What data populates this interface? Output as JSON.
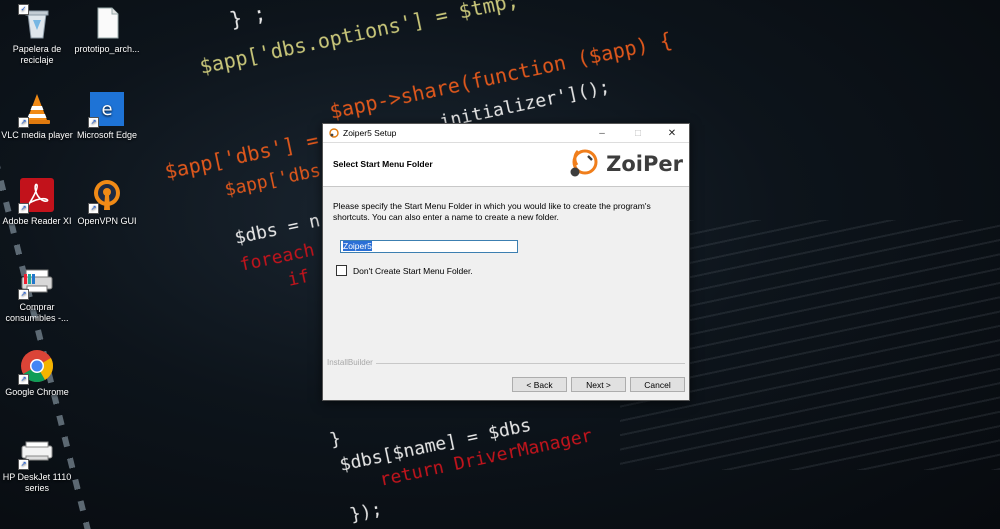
{
  "desktop": {
    "icons": [
      {
        "label": "Papelera de reciclaje",
        "icon": "recycle-bin"
      },
      {
        "label": "prototipo_arch...",
        "icon": "document"
      },
      {
        "label": "VLC media player",
        "icon": "vlc-cone"
      },
      {
        "label": "Microsoft Edge",
        "icon": "edge"
      },
      {
        "label": "Adobe Reader XI",
        "icon": "acrobat"
      },
      {
        "label": "OpenVPN GUI",
        "icon": "openvpn"
      },
      {
        "label": "Comprar consumibles -...",
        "icon": "printer"
      },
      {
        "label": "Google Chrome",
        "icon": "chrome"
      },
      {
        "label": "HP DeskJet 1110 series",
        "icon": "printer"
      }
    ],
    "background_code": [
      "} ;",
      "$app['dbs.options'] = $tmp;",
      "$app->share(function ($app) {",
      "initializer']();",
      "$app['dbs'] = $app",
      "$app['dbs",
      "$dbs = n",
      "foreach",
      "if",
      "}",
      "$dbs[$name] = $dbs",
      "return DriverManager",
      "});"
    ]
  },
  "dialog": {
    "title": "Zoiper5 Setup",
    "header_title": "Select Start Menu Folder",
    "logo_text": "ZoiPer",
    "description": "Please specify the Start Menu Folder in which you would like to create the program's shortcuts. You can also enter a name to create a new folder.",
    "folder_value": "Zoiper5",
    "checkbox_label": "Don't Create Start Menu Folder.",
    "checkbox_checked": false,
    "brand": "InstallBuilder",
    "buttons": {
      "back": "< Back",
      "next": "Next >",
      "cancel": "Cancel"
    },
    "window_controls": {
      "minimize": "–",
      "maximize": "□",
      "close": "✕"
    }
  },
  "colors": {
    "accent": "#2a6fd6",
    "logo_orange": "#f07e1b",
    "dialog_bg": "#f0f0f0"
  }
}
